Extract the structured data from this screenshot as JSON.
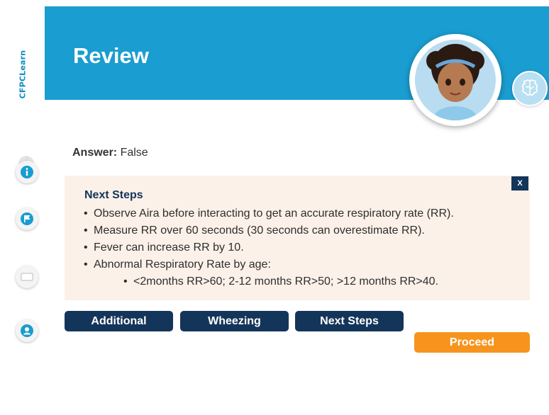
{
  "brand": {
    "name": "CFPCLearn"
  },
  "header": {
    "title": "Review"
  },
  "answer": {
    "label": "Answer:",
    "value": "False"
  },
  "panel": {
    "title": "Next Steps",
    "close_label": "X",
    "bullets": [
      "Observe Aira before interacting to get an accurate respiratory rate (RR).",
      "Measure RR over 60 seconds (30 seconds can overestimate RR).",
      "Fever can increase RR by 10.",
      "Abnormal Respiratory Rate by age:"
    ],
    "sub_bullet": "<2months RR>60; 2-12 months RR>50; >12 months RR>40."
  },
  "tabs": [
    "Additional",
    "Wheezing",
    "Next Steps"
  ],
  "proceed_label": "Proceed",
  "sidebar": {
    "icons": [
      "info-icon",
      "flag-icon",
      "note-icon",
      "profile-icon"
    ]
  },
  "colors": {
    "header": "#1a9dd0",
    "navy": "#14355a",
    "proceed": "#f7941d",
    "panel": "#fbf1e8"
  }
}
